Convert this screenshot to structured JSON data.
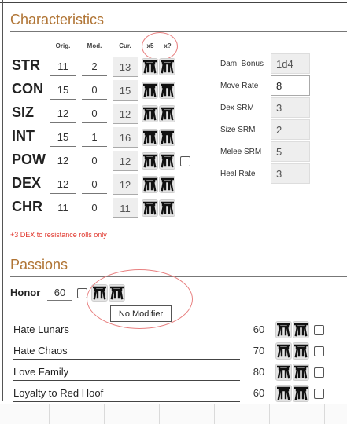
{
  "characteristics": {
    "title": "Characteristics",
    "headers": {
      "orig": "Orig.",
      "mod": "Mod.",
      "cur": "Cur.",
      "x5": "x5",
      "xq": "x?"
    },
    "stats": [
      {
        "name": "STR",
        "orig": "11",
        "mod": "2",
        "cur": "13"
      },
      {
        "name": "CON",
        "orig": "15",
        "mod": "0",
        "cur": "15"
      },
      {
        "name": "SIZ",
        "orig": "12",
        "mod": "0",
        "cur": "12"
      },
      {
        "name": "INT",
        "orig": "15",
        "mod": "1",
        "cur": "16"
      },
      {
        "name": "POW",
        "orig": "12",
        "mod": "0",
        "cur": "12"
      },
      {
        "name": "DEX",
        "orig": "12",
        "mod": "0",
        "cur": "12"
      },
      {
        "name": "CHR",
        "orig": "11",
        "mod": "0",
        "cur": "11"
      }
    ],
    "note": "+3 DEX to resistance rolls only"
  },
  "derived": [
    {
      "label": "Dam. Bonus",
      "value": "1d4"
    },
    {
      "label": "Move Rate",
      "value": "8"
    },
    {
      "label": "Dex SRM",
      "value": "3"
    },
    {
      "label": "Size SRM",
      "value": "2"
    },
    {
      "label": "Melee SRM",
      "value": "5"
    },
    {
      "label": "Heal Rate",
      "value": "3"
    }
  ],
  "passions": {
    "title": "Passions",
    "honor": {
      "label": "Honor",
      "value": "60"
    },
    "tooltip": "No Modifier",
    "items": [
      {
        "label": "Hate Lunars",
        "value": "60"
      },
      {
        "label": "Hate Chaos",
        "value": "70"
      },
      {
        "label": "Love Family",
        "value": "80"
      },
      {
        "label": "Loyalty to Red Hoof",
        "value": "60"
      }
    ]
  },
  "icons": {
    "dice_button": "d20-dice-icon",
    "highlight": "#e88080",
    "title_color": "#b07434",
    "note_color": "#e0342a"
  }
}
